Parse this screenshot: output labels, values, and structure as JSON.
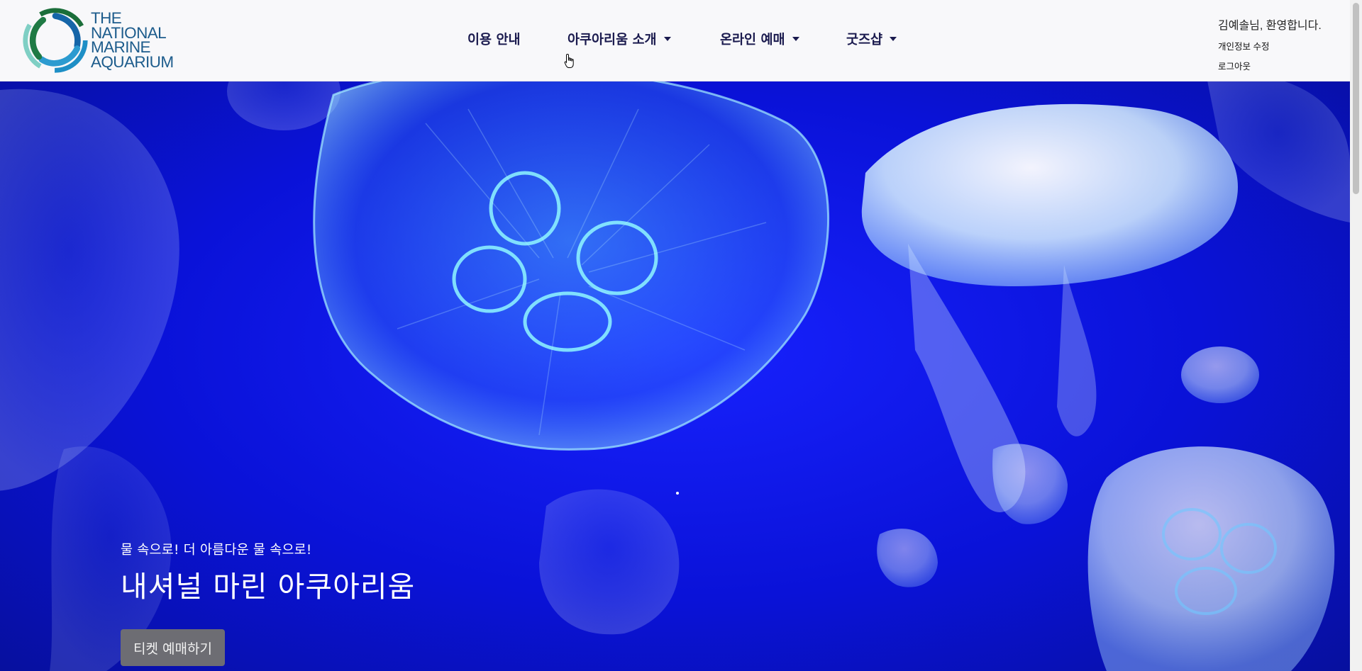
{
  "header": {
    "logo": {
      "lines": [
        "THE",
        "NATIONAL",
        "MARINE",
        "AQUARIUM"
      ],
      "color": "#1d5c8c"
    },
    "nav": [
      {
        "label": "이용 안내",
        "has_dropdown": false
      },
      {
        "label": "아쿠아리움 소개",
        "has_dropdown": true
      },
      {
        "label": "온라인 예매",
        "has_dropdown": true
      },
      {
        "label": "굿즈샵",
        "has_dropdown": true
      }
    ],
    "user": {
      "welcome": "김예솔님, 환영합니다.",
      "edit_profile": "개인정보 수정",
      "logout": "로그아웃"
    }
  },
  "hero": {
    "background_color": "#0a12d8",
    "subtitle": "물 속으로! 더 아름다운 물 속으로!",
    "title": "내셔널 마린 아쿠아리움",
    "cta_label": "티켓 예매하기"
  }
}
